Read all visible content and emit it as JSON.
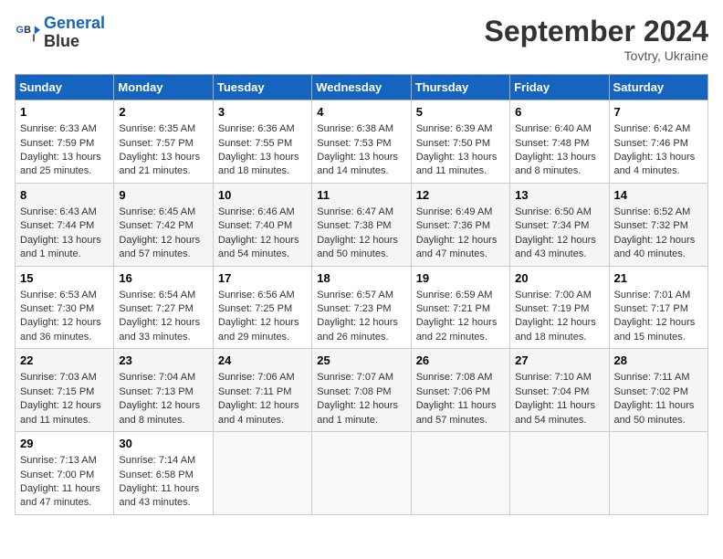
{
  "header": {
    "logo_line1": "General",
    "logo_line2": "Blue",
    "month_title": "September 2024",
    "location": "Tovtry, Ukraine"
  },
  "days_of_week": [
    "Sunday",
    "Monday",
    "Tuesday",
    "Wednesday",
    "Thursday",
    "Friday",
    "Saturday"
  ],
  "weeks": [
    [
      {
        "day": "1",
        "info": "Sunrise: 6:33 AM\nSunset: 7:59 PM\nDaylight: 13 hours\nand 25 minutes."
      },
      {
        "day": "2",
        "info": "Sunrise: 6:35 AM\nSunset: 7:57 PM\nDaylight: 13 hours\nand 21 minutes."
      },
      {
        "day": "3",
        "info": "Sunrise: 6:36 AM\nSunset: 7:55 PM\nDaylight: 13 hours\nand 18 minutes."
      },
      {
        "day": "4",
        "info": "Sunrise: 6:38 AM\nSunset: 7:53 PM\nDaylight: 13 hours\nand 14 minutes."
      },
      {
        "day": "5",
        "info": "Sunrise: 6:39 AM\nSunset: 7:50 PM\nDaylight: 13 hours\nand 11 minutes."
      },
      {
        "day": "6",
        "info": "Sunrise: 6:40 AM\nSunset: 7:48 PM\nDaylight: 13 hours\nand 8 minutes."
      },
      {
        "day": "7",
        "info": "Sunrise: 6:42 AM\nSunset: 7:46 PM\nDaylight: 13 hours\nand 4 minutes."
      }
    ],
    [
      {
        "day": "8",
        "info": "Sunrise: 6:43 AM\nSunset: 7:44 PM\nDaylight: 13 hours\nand 1 minute."
      },
      {
        "day": "9",
        "info": "Sunrise: 6:45 AM\nSunset: 7:42 PM\nDaylight: 12 hours\nand 57 minutes."
      },
      {
        "day": "10",
        "info": "Sunrise: 6:46 AM\nSunset: 7:40 PM\nDaylight: 12 hours\nand 54 minutes."
      },
      {
        "day": "11",
        "info": "Sunrise: 6:47 AM\nSunset: 7:38 PM\nDaylight: 12 hours\nand 50 minutes."
      },
      {
        "day": "12",
        "info": "Sunrise: 6:49 AM\nSunset: 7:36 PM\nDaylight: 12 hours\nand 47 minutes."
      },
      {
        "day": "13",
        "info": "Sunrise: 6:50 AM\nSunset: 7:34 PM\nDaylight: 12 hours\nand 43 minutes."
      },
      {
        "day": "14",
        "info": "Sunrise: 6:52 AM\nSunset: 7:32 PM\nDaylight: 12 hours\nand 40 minutes."
      }
    ],
    [
      {
        "day": "15",
        "info": "Sunrise: 6:53 AM\nSunset: 7:30 PM\nDaylight: 12 hours\nand 36 minutes."
      },
      {
        "day": "16",
        "info": "Sunrise: 6:54 AM\nSunset: 7:27 PM\nDaylight: 12 hours\nand 33 minutes."
      },
      {
        "day": "17",
        "info": "Sunrise: 6:56 AM\nSunset: 7:25 PM\nDaylight: 12 hours\nand 29 minutes."
      },
      {
        "day": "18",
        "info": "Sunrise: 6:57 AM\nSunset: 7:23 PM\nDaylight: 12 hours\nand 26 minutes."
      },
      {
        "day": "19",
        "info": "Sunrise: 6:59 AM\nSunset: 7:21 PM\nDaylight: 12 hours\nand 22 minutes."
      },
      {
        "day": "20",
        "info": "Sunrise: 7:00 AM\nSunset: 7:19 PM\nDaylight: 12 hours\nand 18 minutes."
      },
      {
        "day": "21",
        "info": "Sunrise: 7:01 AM\nSunset: 7:17 PM\nDaylight: 12 hours\nand 15 minutes."
      }
    ],
    [
      {
        "day": "22",
        "info": "Sunrise: 7:03 AM\nSunset: 7:15 PM\nDaylight: 12 hours\nand 11 minutes."
      },
      {
        "day": "23",
        "info": "Sunrise: 7:04 AM\nSunset: 7:13 PM\nDaylight: 12 hours\nand 8 minutes."
      },
      {
        "day": "24",
        "info": "Sunrise: 7:06 AM\nSunset: 7:11 PM\nDaylight: 12 hours\nand 4 minutes."
      },
      {
        "day": "25",
        "info": "Sunrise: 7:07 AM\nSunset: 7:08 PM\nDaylight: 12 hours\nand 1 minute."
      },
      {
        "day": "26",
        "info": "Sunrise: 7:08 AM\nSunset: 7:06 PM\nDaylight: 11 hours\nand 57 minutes."
      },
      {
        "day": "27",
        "info": "Sunrise: 7:10 AM\nSunset: 7:04 PM\nDaylight: 11 hours\nand 54 minutes."
      },
      {
        "day": "28",
        "info": "Sunrise: 7:11 AM\nSunset: 7:02 PM\nDaylight: 11 hours\nand 50 minutes."
      }
    ],
    [
      {
        "day": "29",
        "info": "Sunrise: 7:13 AM\nSunset: 7:00 PM\nDaylight: 11 hours\nand 47 minutes."
      },
      {
        "day": "30",
        "info": "Sunrise: 7:14 AM\nSunset: 6:58 PM\nDaylight: 11 hours\nand 43 minutes."
      },
      {
        "day": "",
        "info": ""
      },
      {
        "day": "",
        "info": ""
      },
      {
        "day": "",
        "info": ""
      },
      {
        "day": "",
        "info": ""
      },
      {
        "day": "",
        "info": ""
      }
    ]
  ]
}
